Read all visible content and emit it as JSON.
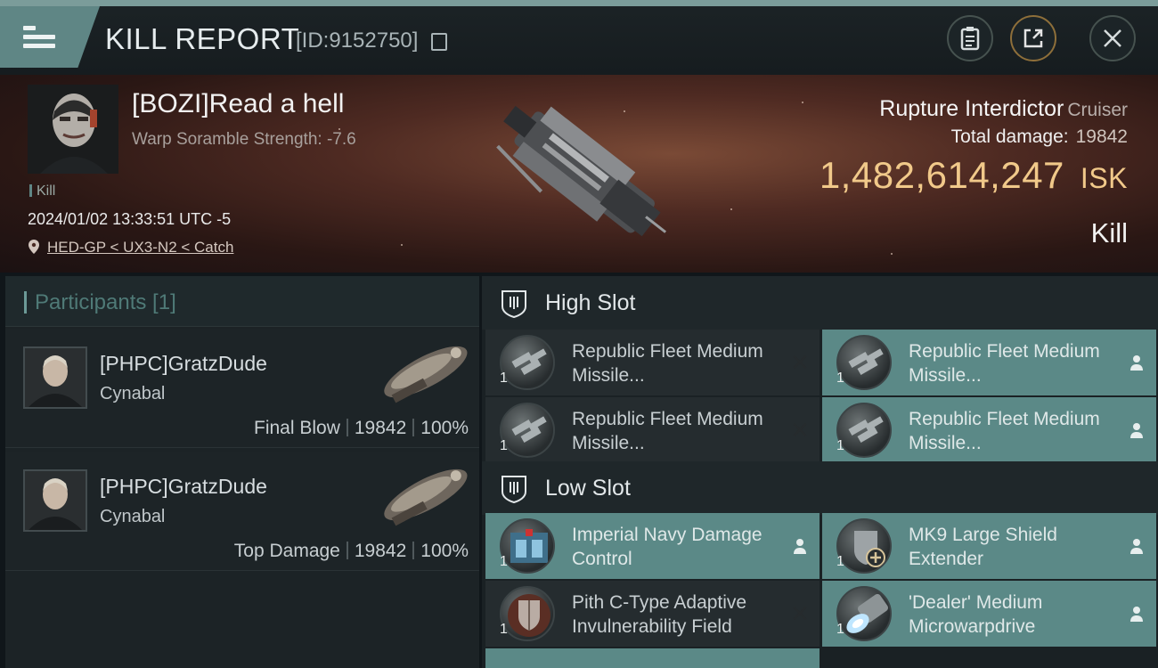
{
  "header": {
    "title": "KILL REPORT",
    "kill_id": "[ID:9152750]",
    "icons": [
      "menu-icon",
      "copy-icon",
      "clipboard-icon",
      "share-icon",
      "close-icon"
    ]
  },
  "victim": {
    "name": "[BOZI]Read a hell",
    "scramble": "Warp Soramble Strength: -7.6",
    "tag": "Kill",
    "datetime": "2024/01/02 13:33:51 UTC -5",
    "location": "HED-GP < UX3-N2 < Catch",
    "ship_name": "Rupture Interdictor",
    "ship_class": "Cruiser",
    "total_damage_label": "Total damage:",
    "total_damage": "19842",
    "isk_value": "1,482,614,247",
    "isk_unit": "ISK",
    "result": "Kill"
  },
  "participants": {
    "title": "Participants [1]",
    "rows": [
      {
        "name": "[PHPC]GratzDude",
        "ship": "Cynabal",
        "role": "Final Blow",
        "damage": "19842",
        "percent": "100%"
      },
      {
        "name": "[PHPC]GratzDude",
        "ship": "Cynabal",
        "role": "Top Damage",
        "damage": "19842",
        "percent": "100%"
      }
    ]
  },
  "fitting": {
    "high_slot_label": "High Slot",
    "low_slot_label": "Low Slot",
    "high": [
      {
        "name": "Republic Fleet Medium Missile...",
        "qty": "1",
        "status": "destroyed"
      },
      {
        "name": "Republic Fleet Medium Missile...",
        "qty": "1",
        "status": "dropped"
      },
      {
        "name": "Republic Fleet Medium Missile...",
        "qty": "1",
        "status": "destroyed"
      },
      {
        "name": "Republic Fleet Medium Missile...",
        "qty": "1",
        "status": "dropped"
      }
    ],
    "low": [
      {
        "name": "Imperial Navy Damage Control",
        "qty": "1",
        "status": "dropped"
      },
      {
        "name": "MK9 Large Shield Extender",
        "qty": "1",
        "status": "dropped"
      },
      {
        "name": "Pith C-Type Adaptive Invulnerability Field",
        "qty": "1",
        "status": "destroyed"
      },
      {
        "name": "'Dealer' Medium Microwarpdrive",
        "qty": "1",
        "status": "dropped"
      }
    ],
    "colors": {
      "dropped": "#5b8987",
      "destroyed": "#252c2f"
    }
  }
}
